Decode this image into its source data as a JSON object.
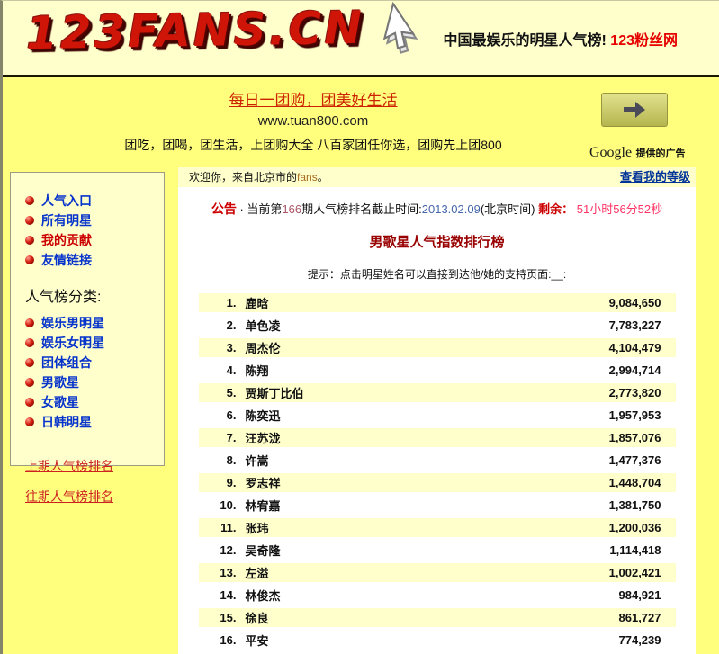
{
  "header": {
    "logo": "123FANS.CN",
    "tagline_black": "中国最娱乐的明星人气榜!",
    "tagline_red": "123粉丝网"
  },
  "ad": {
    "line1": "每日一团购，团美好生活",
    "line2": "www.tuan800.com",
    "line3": "团吃，团喝，团生活，上团购大全 八百家团任你选，团购先上团800",
    "google_brand": "Google",
    "google_label": "提供的广告"
  },
  "sidebar": {
    "main_links": [
      {
        "label": "人气入口"
      },
      {
        "label": "所有明星"
      },
      {
        "label": "我的贡献",
        "highlight": true
      },
      {
        "label": "友情链接"
      }
    ],
    "category_heading": "人气榜分类:",
    "category_links": [
      {
        "label": "娱乐男明星"
      },
      {
        "label": "娱乐女明星"
      },
      {
        "label": "团体组合"
      },
      {
        "label": "男歌星"
      },
      {
        "label": "女歌星"
      },
      {
        "label": "日韩明星"
      }
    ],
    "history_links": {
      "previous": "上期人气榜排名",
      "past": "往期人气榜排名"
    }
  },
  "main": {
    "welcome": {
      "prefix": "欢迎你，来自北京市的",
      "fans": "fans",
      "suffix": "。",
      "level_link": "查看我的等级"
    },
    "announcement": {
      "label": "公告",
      "separator": " · ",
      "seg1": "当前第",
      "issue": "166",
      "seg2": "期人气榜排名截止时间:",
      "date": "2013.02.09",
      "seg3": "(北京时间) ",
      "remain_label": "剩余： ",
      "remain_value": "51小时56分52秒"
    },
    "title": "男歌星人气指数排行榜",
    "hint": "提示：点击明星姓名可以直接到达他/她的支持页面:__:",
    "ranking": [
      {
        "rank": "1.",
        "name": "鹿晗",
        "value": "9,084,650"
      },
      {
        "rank": "2.",
        "name": "单色凌",
        "value": "7,783,227"
      },
      {
        "rank": "3.",
        "name": "周杰伦",
        "value": "4,104,479"
      },
      {
        "rank": "4.",
        "name": "陈翔",
        "value": "2,994,714"
      },
      {
        "rank": "5.",
        "name": "贾斯丁比伯",
        "value": "2,773,820"
      },
      {
        "rank": "6.",
        "name": "陈奕迅",
        "value": "1,957,953"
      },
      {
        "rank": "7.",
        "name": "汪苏泷",
        "value": "1,857,076"
      },
      {
        "rank": "8.",
        "name": "许嵩",
        "value": "1,477,376"
      },
      {
        "rank": "9.",
        "name": "罗志祥",
        "value": "1,448,704"
      },
      {
        "rank": "10.",
        "name": "林宥嘉",
        "value": "1,381,750"
      },
      {
        "rank": "11.",
        "name": "张玮",
        "value": "1,200,036"
      },
      {
        "rank": "12.",
        "name": "吴奇隆",
        "value": "1,114,418"
      },
      {
        "rank": "13.",
        "name": "左溢",
        "value": "1,002,421"
      },
      {
        "rank": "14.",
        "name": "林俊杰",
        "value": "984,921"
      },
      {
        "rank": "15.",
        "name": "徐良",
        "value": "861,727"
      },
      {
        "rank": "16.",
        "name": "平安",
        "value": "774,239"
      }
    ]
  },
  "colors": {
    "page_yellow": "#ffff7d",
    "pale_yellow": "#ffffcc",
    "logo_red": "#cf1408",
    "link_blue": "#0633cc",
    "title_red": "#990000",
    "countdown_pink": "#ff3366"
  }
}
